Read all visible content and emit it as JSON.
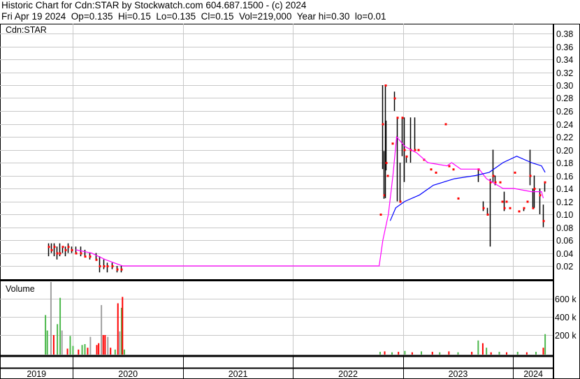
{
  "header": {
    "title": "Historic Chart for Cdn:STAR by Stockwatch.com 604.687.1500 - (c) 2024",
    "quote": "Fri Apr 19 2024  Op=0.135  Hi=0.15  Lo=0.135  Cl=0.15  Vol=219,000  Year hi=0.30  lo=0.01"
  },
  "colors": {
    "bar": "#000000",
    "close": "#ff0000",
    "ma_short": "#ff00ff",
    "ma_long": "#0000ff",
    "vol_up": "#4cb84c",
    "vol_down": "#ff0000",
    "vol_flat": "#a0a0a0",
    "grid": "#c8c8c8"
  },
  "chart_data": [
    {
      "type": "line",
      "title": "Cdn:STAR",
      "x_unit": "months since Jan 2019",
      "ylim": [
        0,
        0.39
      ],
      "y_ticks": [
        "0.02",
        "0.04",
        "0.06",
        "0.08",
        "0.10",
        "0.12",
        "0.14",
        "0.16",
        "0.18",
        "0.20",
        "0.22",
        "0.24",
        "0.26",
        "0.28",
        "0.30",
        "0.32",
        "0.34",
        "0.36",
        "0.38"
      ],
      "x_ticks": [
        "2019",
        "2020",
        "2021",
        "2022",
        "2023",
        "2024"
      ],
      "bars_columns": [
        "month",
        "low",
        "high",
        "close"
      ],
      "bars": [
        [
          9.3,
          0.035,
          0.055,
          0.05
        ],
        [
          9.6,
          0.04,
          0.055,
          0.045
        ],
        [
          9.9,
          0.035,
          0.055,
          0.05
        ],
        [
          10.2,
          0.03,
          0.05,
          0.04
        ],
        [
          10.5,
          0.035,
          0.055,
          0.04
        ],
        [
          10.8,
          0.04,
          0.05,
          0.05
        ],
        [
          11.1,
          0.035,
          0.05,
          0.045
        ],
        [
          11.4,
          0.04,
          0.055,
          0.05
        ],
        [
          11.8,
          0.04,
          0.05,
          0.045
        ],
        [
          12.3,
          0.04,
          0.05,
          0.04
        ],
        [
          12.8,
          0.035,
          0.05,
          0.04
        ],
        [
          13.3,
          0.035,
          0.045,
          0.035
        ],
        [
          13.8,
          0.03,
          0.04,
          0.035
        ],
        [
          14.5,
          0.03,
          0.04,
          0.03
        ],
        [
          14.9,
          0.01,
          0.035,
          0.02
        ],
        [
          15.3,
          0.015,
          0.03,
          0.02
        ],
        [
          15.7,
          0.01,
          0.025,
          0.02
        ],
        [
          16.2,
          0.015,
          0.025,
          0.02
        ],
        [
          16.8,
          0.01,
          0.02,
          0.015
        ],
        [
          17.2,
          0.01,
          0.02,
          0.015
        ],
        [
          45.5,
          0.1,
          0.1,
          0.1
        ],
        [
          45.7,
          0.17,
          0.3,
          0.24
        ],
        [
          45.9,
          0.124,
          0.198,
          0.13
        ],
        [
          46.0,
          0.125,
          0.3,
          0.3
        ],
        [
          46.1,
          0.168,
          0.245,
          0.18
        ],
        [
          46.3,
          0.16,
          0.16,
          0.16
        ],
        [
          46.8,
          0.21,
          0.21,
          0.21
        ],
        [
          47.0,
          0.26,
          0.29,
          0.28
        ],
        [
          47.3,
          0.12,
          0.25,
          0.25
        ],
        [
          47.6,
          0.12,
          0.18,
          0.12
        ],
        [
          47.9,
          0.19,
          0.25,
          0.25
        ],
        [
          48.1,
          0.15,
          0.25,
          0.2
        ],
        [
          48.3,
          0.18,
          0.19,
          0.19
        ],
        [
          48.8,
          0.18,
          0.25,
          0.2
        ],
        [
          49.2,
          0.2,
          0.25,
          0.2
        ],
        [
          49.6,
          0.2,
          0.2,
          0.2
        ],
        [
          50.2,
          0.185,
          0.185,
          0.185
        ],
        [
          51.0,
          0.17,
          0.17,
          0.17
        ],
        [
          51.5,
          0.165,
          0.165,
          0.165
        ],
        [
          52.6,
          0.24,
          0.24,
          0.24
        ],
        [
          53.0,
          0.175,
          0.175,
          0.175
        ],
        [
          53.4,
          0.17,
          0.17,
          0.17
        ],
        [
          54.0,
          0.125,
          0.125,
          0.125
        ],
        [
          56.2,
          0.15,
          0.17,
          0.17
        ],
        [
          56.7,
          0.105,
          0.12,
          0.11
        ],
        [
          57.2,
          0.1,
          0.11,
          0.1
        ],
        [
          57.5,
          0.05,
          0.155,
          0.15
        ],
        [
          57.8,
          0.15,
          0.2,
          0.16
        ],
        [
          58.0,
          0.145,
          0.16,
          0.15
        ],
        [
          58.5,
          0.15,
          0.15,
          0.15
        ],
        [
          58.8,
          0.12,
          0.12,
          0.12
        ],
        [
          59.0,
          0.105,
          0.135,
          0.11
        ],
        [
          59.2,
          0.12,
          0.12,
          0.12
        ],
        [
          59.6,
          0.11,
          0.11,
          0.11
        ],
        [
          60.1,
          0.165,
          0.165,
          0.165
        ],
        [
          60.6,
          0.105,
          0.105,
          0.105
        ],
        [
          61.1,
          0.105,
          0.11,
          0.11
        ],
        [
          61.5,
          0.12,
          0.12,
          0.12
        ],
        [
          61.8,
          0.145,
          0.2,
          0.16
        ],
        [
          62.1,
          0.11,
          0.14,
          0.11
        ],
        [
          62.3,
          0.11,
          0.16,
          0.14
        ],
        [
          62.9,
          0.1,
          0.14,
          0.13
        ],
        [
          63.3,
          0.08,
          0.115,
          0.09
        ],
        [
          63.4,
          0.135,
          0.15,
          0.15
        ]
      ],
      "series": [
        {
          "name": "short moving average",
          "color": "#ff00ff",
          "points": [
            [
              12.3,
              0.045
            ],
            [
              14.0,
              0.04
            ],
            [
              15.5,
              0.03
            ],
            [
              17.4,
              0.02
            ],
            [
              45.4,
              0.02
            ],
            [
              45.8,
              0.06
            ],
            [
              46.4,
              0.1
            ],
            [
              46.9,
              0.16
            ],
            [
              47.3,
              0.22
            ],
            [
              47.6,
              0.215
            ],
            [
              48.2,
              0.205
            ],
            [
              49.5,
              0.195
            ],
            [
              50.7,
              0.18
            ],
            [
              52.8,
              0.175
            ],
            [
              53.3,
              0.18
            ],
            [
              54.3,
              0.17
            ],
            [
              56.3,
              0.17
            ],
            [
              57.1,
              0.155
            ],
            [
              58.9,
              0.14
            ],
            [
              60.1,
              0.14
            ],
            [
              62.0,
              0.135
            ],
            [
              63.1,
              0.135
            ],
            [
              63.3,
              0.125
            ]
          ]
        },
        {
          "name": "long moving average",
          "color": "#0000ff",
          "points": [
            [
              46.6,
              0.09
            ],
            [
              47.2,
              0.11
            ],
            [
              48.2,
              0.12
            ],
            [
              49.8,
              0.13
            ],
            [
              51.3,
              0.145
            ],
            [
              53.6,
              0.155
            ],
            [
              55.9,
              0.16
            ],
            [
              57.4,
              0.165
            ],
            [
              58.9,
              0.18
            ],
            [
              60.4,
              0.19
            ],
            [
              62.0,
              0.18
            ],
            [
              63.1,
              0.175
            ],
            [
              63.5,
              0.165
            ]
          ]
        }
      ]
    },
    {
      "type": "bar",
      "title": "Volume",
      "x_unit": "months since Jan 2019",
      "ylim": [
        0,
        750
      ],
      "y_ticks": [
        "200 k",
        "400 k",
        "600 k"
      ],
      "y_tick_values": [
        200,
        400,
        600
      ],
      "bars_columns": [
        "month",
        "volume_k",
        "direction"
      ],
      "bars": [
        [
          9.0,
          420,
          "up"
        ],
        [
          9.2,
          250,
          "up"
        ],
        [
          9.6,
          820,
          "flat"
        ],
        [
          9.9,
          200,
          "down"
        ],
        [
          10.3,
          320,
          "up"
        ],
        [
          10.6,
          610,
          "up"
        ],
        [
          10.8,
          250,
          "flat"
        ],
        [
          11.4,
          50,
          "down"
        ],
        [
          11.7,
          190,
          "up"
        ],
        [
          12.0,
          80,
          "up"
        ],
        [
          12.6,
          40,
          "down"
        ],
        [
          13.0,
          90,
          "up"
        ],
        [
          13.3,
          100,
          "up"
        ],
        [
          13.6,
          60,
          "down"
        ],
        [
          13.9,
          180,
          "flat"
        ],
        [
          14.6,
          90,
          "down"
        ],
        [
          14.8,
          110,
          "down"
        ],
        [
          15.1,
          530,
          "flat"
        ],
        [
          15.3,
          200,
          "down"
        ],
        [
          15.5,
          200,
          "down"
        ],
        [
          15.8,
          180,
          "flat"
        ],
        [
          16.1,
          60,
          "down"
        ],
        [
          16.6,
          40,
          "up"
        ],
        [
          16.9,
          550,
          "down"
        ],
        [
          17.1,
          240,
          "flat"
        ],
        [
          17.3,
          500,
          "up"
        ],
        [
          17.4,
          620,
          "down"
        ],
        [
          17.6,
          40,
          "up"
        ],
        [
          45.5,
          15,
          "up"
        ],
        [
          46.0,
          20,
          "down"
        ],
        [
          46.8,
          10,
          "up"
        ],
        [
          47.5,
          15,
          "down"
        ],
        [
          48.2,
          25,
          "up"
        ],
        [
          49.0,
          10,
          "down"
        ],
        [
          50.0,
          20,
          "up"
        ],
        [
          51.2,
          15,
          "down"
        ],
        [
          52.0,
          10,
          "up"
        ],
        [
          53.0,
          20,
          "down"
        ],
        [
          54.0,
          10,
          "up"
        ],
        [
          55.5,
          15,
          "down"
        ],
        [
          56.2,
          140,
          "up"
        ],
        [
          56.7,
          110,
          "down"
        ],
        [
          57.1,
          60,
          "up"
        ],
        [
          57.6,
          10,
          "down"
        ],
        [
          58.5,
          15,
          "up"
        ],
        [
          59.3,
          10,
          "down"
        ],
        [
          60.5,
          15,
          "up"
        ],
        [
          61.5,
          10,
          "down"
        ],
        [
          62.5,
          15,
          "up"
        ],
        [
          63.3,
          60,
          "down"
        ],
        [
          63.5,
          210,
          "up"
        ]
      ]
    }
  ]
}
